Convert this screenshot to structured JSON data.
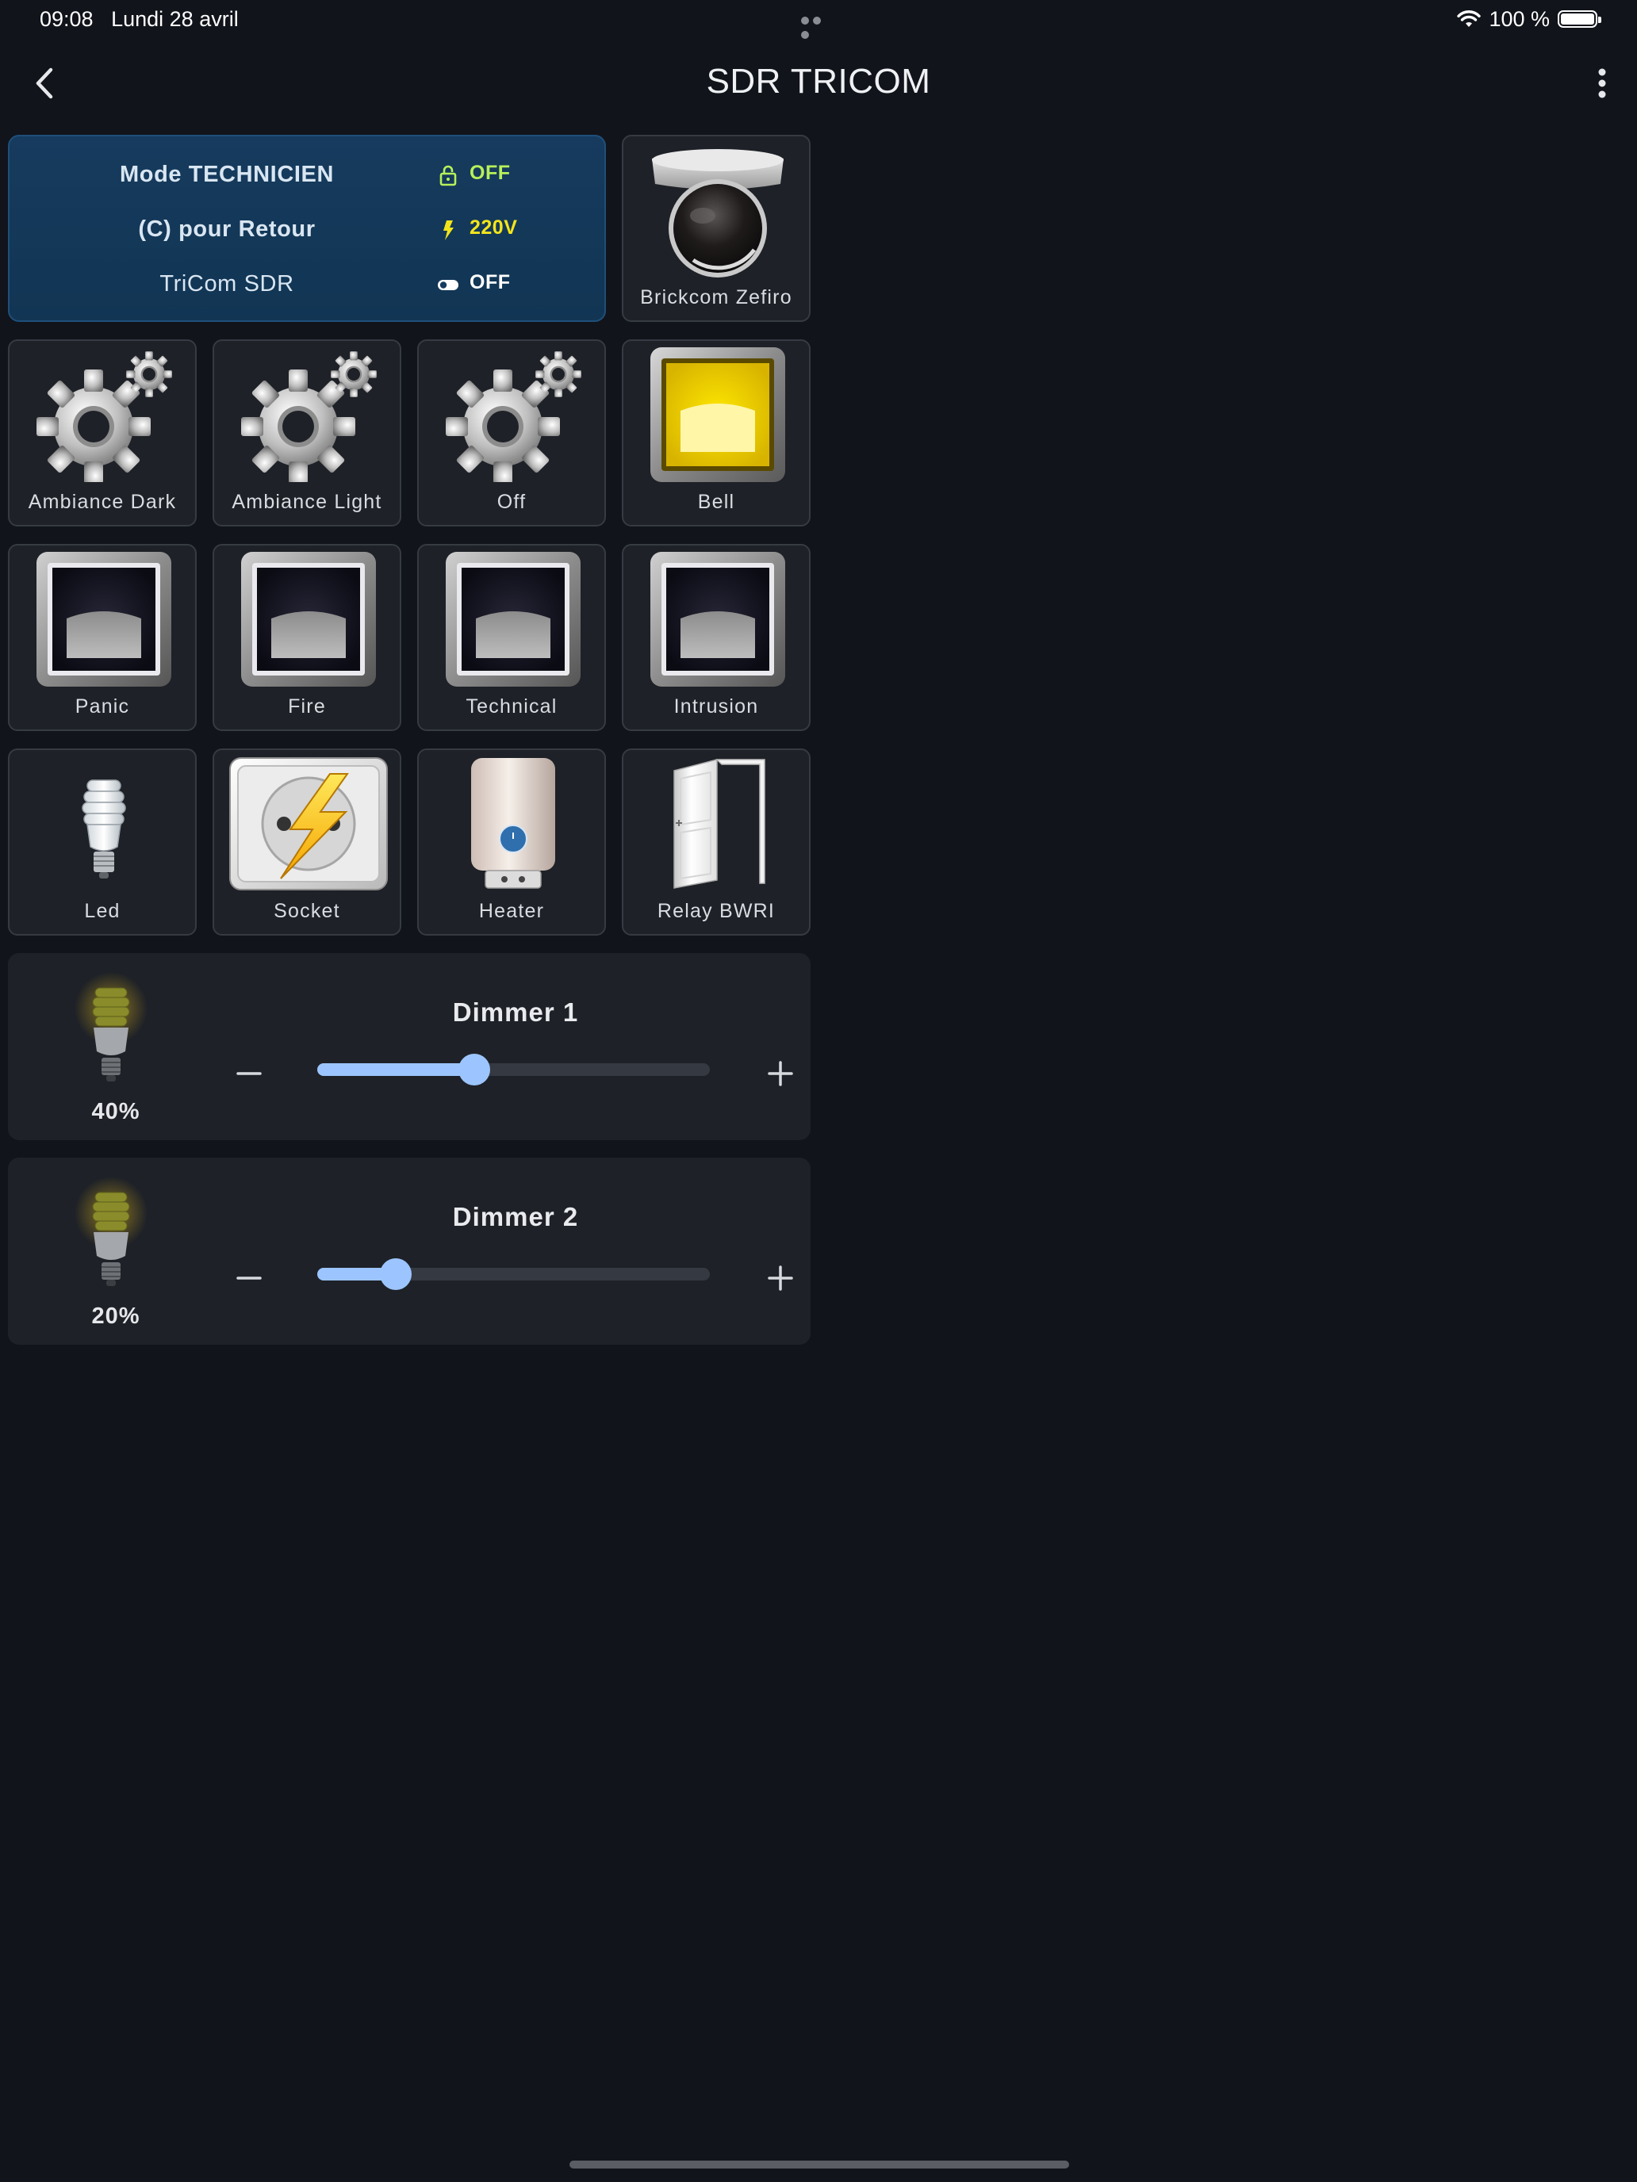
{
  "status_bar": {
    "time": "09:08",
    "date": "Lundi 28 avril",
    "battery": "100 %"
  },
  "nav": {
    "title": "SDR TRICOM",
    "back_icon": "chevron-left-icon",
    "menu_icon": "more-vertical-icon"
  },
  "info_card": {
    "rows": [
      {
        "label": "Mode TECHNICIEN",
        "icon": "lock-icon",
        "value": "OFF",
        "color": "#b7f05a"
      },
      {
        "label": "(C) pour Retour",
        "icon": "bolt-icon",
        "value": "220V",
        "color": "#f2e51c"
      },
      {
        "label": "TriCom SDR",
        "icon": "toggle-icon",
        "value": "OFF",
        "color": "#ffffff"
      }
    ]
  },
  "tiles": {
    "camera": {
      "label": "Brickcom Zefiro",
      "icon": "dome-camera-icon"
    },
    "ambiance_dark": {
      "label": "Ambiance Dark",
      "icon": "gear-icon"
    },
    "ambiance_light": {
      "label": "Ambiance Light",
      "icon": "gear-icon"
    },
    "off": {
      "label": "Off",
      "icon": "gear-icon"
    },
    "bell": {
      "label": "Bell",
      "icon": "yellow-button-icon"
    },
    "panic": {
      "label": "Panic",
      "icon": "dark-button-icon"
    },
    "fire": {
      "label": "Fire",
      "icon": "dark-button-icon"
    },
    "technical": {
      "label": "Technical",
      "icon": "dark-button-icon"
    },
    "intrusion": {
      "label": "Intrusion",
      "icon": "dark-button-icon"
    },
    "led": {
      "label": "Led",
      "icon": "bulb-icon"
    },
    "socket": {
      "label": "Socket",
      "icon": "socket-bolt-icon"
    },
    "heater": {
      "label": "Heater",
      "icon": "water-heater-icon"
    },
    "relay": {
      "label": "Relay BWRI",
      "icon": "open-door-icon"
    }
  },
  "dimmers": [
    {
      "title": "Dimmer 1",
      "percent_label": "40%",
      "level": 0.4
    },
    {
      "title": "Dimmer 2",
      "percent_label": "20%",
      "level": 0.2
    }
  ],
  "colors": {
    "accent": "#9cc5ff",
    "card_blue": "#163b5e",
    "tile_bg": "#1e2127"
  }
}
